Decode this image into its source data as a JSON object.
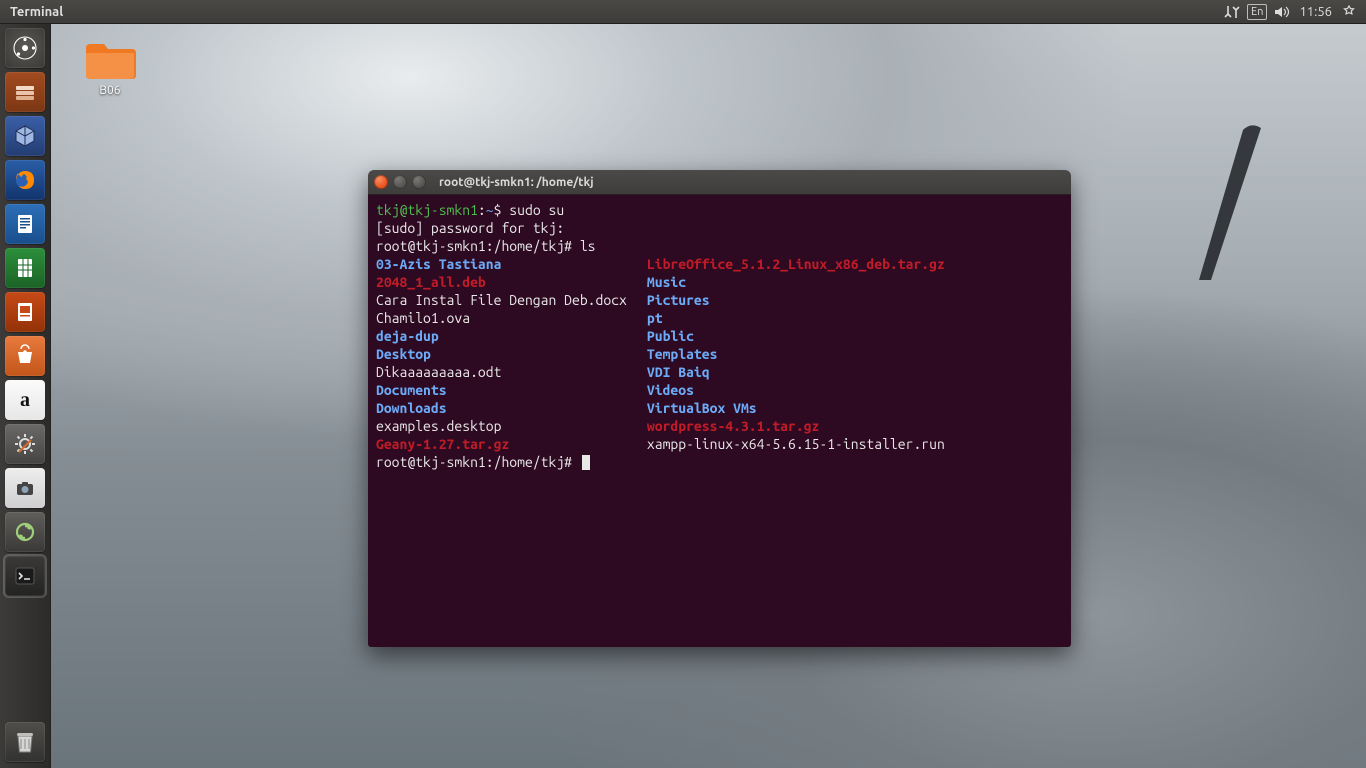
{
  "menubar": {
    "app_title": "Terminal",
    "lang": "En",
    "time": "11:56"
  },
  "desktop": {
    "folder": {
      "label": "B06"
    }
  },
  "launcher": {
    "items": [
      {
        "name": "dash"
      },
      {
        "name": "files"
      },
      {
        "name": "virtualbox"
      },
      {
        "name": "firefox"
      },
      {
        "name": "writer"
      },
      {
        "name": "calc"
      },
      {
        "name": "impress"
      },
      {
        "name": "software-center"
      },
      {
        "name": "amazon"
      },
      {
        "name": "settings"
      },
      {
        "name": "screenshot"
      },
      {
        "name": "updates"
      },
      {
        "name": "terminal"
      }
    ],
    "trash": {
      "name": "trash"
    }
  },
  "terminal": {
    "title": "root@tkj-smkn1: /home/tkj",
    "prompt1_user": "tkj@tkj-smkn1",
    "prompt1_path": "~",
    "cmd1": "sudo su",
    "sudo_line": "[sudo] password for tkj:",
    "root_prompt": "root@tkj-smkn1:/home/tkj#",
    "cmd2": "ls",
    "col1": [
      {
        "t": "03-Azis Tastiana",
        "c": "dir"
      },
      {
        "t": "2048_1_all.deb",
        "c": "arch"
      },
      {
        "t": "Cara Instal File Dengan Deb.docx",
        "c": "file"
      },
      {
        "t": "Chamilo1.ova",
        "c": "file"
      },
      {
        "t": "deja-dup",
        "c": "dir"
      },
      {
        "t": "Desktop",
        "c": "dir"
      },
      {
        "t": "Dikaaaaaaaaa.odt",
        "c": "file"
      },
      {
        "t": "Documents",
        "c": "dir"
      },
      {
        "t": "Downloads",
        "c": "dir"
      },
      {
        "t": "examples.desktop",
        "c": "file"
      },
      {
        "t": "Geany-1.27.tar.gz",
        "c": "arch"
      }
    ],
    "col2": [
      {
        "t": "LibreOffice_5.1.2_Linux_x86_deb.tar.gz",
        "c": "arch"
      },
      {
        "t": "Music",
        "c": "dir"
      },
      {
        "t": "Pictures",
        "c": "dir"
      },
      {
        "t": "pt",
        "c": "dir"
      },
      {
        "t": "Public",
        "c": "dir"
      },
      {
        "t": "Templates",
        "c": "dir"
      },
      {
        "t": "VDI Baiq",
        "c": "dir"
      },
      {
        "t": "Videos",
        "c": "dir"
      },
      {
        "t": "VirtualBox VMs",
        "c": "dir"
      },
      {
        "t": "wordpress-4.3.1.tar.gz",
        "c": "arch"
      },
      {
        "t": "xampp-linux-x64-5.6.15-1-installer.run",
        "c": "file"
      }
    ]
  }
}
